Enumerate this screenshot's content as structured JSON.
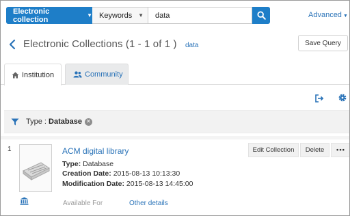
{
  "search": {
    "scope_label": "Electronic collection",
    "field_label": "Keywords",
    "query_value": "data",
    "advanced_label": "Advanced"
  },
  "header": {
    "title": "Electronic Collections",
    "count": "(1 - 1 of 1 )",
    "query_tag": "data",
    "save_query_label": "Save Query"
  },
  "tabs": [
    {
      "label": "Institution",
      "active": true
    },
    {
      "label": "Community",
      "active": false
    }
  ],
  "facet": {
    "label": "Type : ",
    "value": "Database"
  },
  "results": [
    {
      "index": "1",
      "title": "ACM digital library",
      "type_label": "Type:",
      "type_value": "Database",
      "created_label": "Creation Date:",
      "created_value": "2015-08-13 10:13:30",
      "modified_label": "Modification Date:",
      "modified_value": "2015-08-13 14:45:00",
      "available_label": "Available For",
      "other_details_label": "Other details",
      "actions": {
        "edit": "Edit Collection",
        "delete": "Delete",
        "more": "•••"
      }
    }
  ],
  "colors": {
    "accent": "#1e7ec8",
    "link": "#2a73b8"
  }
}
